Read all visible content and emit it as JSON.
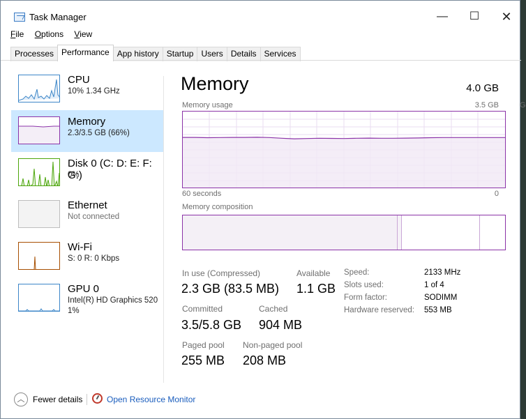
{
  "window": {
    "title": "Task Manager",
    "controls": {
      "minimize": "—",
      "maximize": "☐",
      "close": "✕"
    }
  },
  "menu": [
    "File",
    "Options",
    "View"
  ],
  "tabs": [
    {
      "label": "Processes",
      "active": false
    },
    {
      "label": "Performance",
      "active": true
    },
    {
      "label": "App history",
      "active": false
    },
    {
      "label": "Startup",
      "active": false
    },
    {
      "label": "Users",
      "active": false
    },
    {
      "label": "Details",
      "active": false
    },
    {
      "label": "Services",
      "active": false
    }
  ],
  "sidebar": {
    "items": [
      {
        "name": "CPU",
        "sub": "10% 1.34 GHz",
        "selected": false,
        "graph_color": "#3c86c8"
      },
      {
        "name": "Memory",
        "sub": "2.3/3.5 GB (66%)",
        "selected": true,
        "graph_color": "#8b33a8"
      },
      {
        "name": "Disk 0 (C: D: E: F: G:)",
        "sub": "0%",
        "selected": false,
        "graph_color": "#4da60c"
      },
      {
        "name": "Ethernet",
        "sub": "Not connected",
        "selected": false,
        "graph_color": "#bdbdbd"
      },
      {
        "name": "Wi-Fi",
        "sub": "S: 0 R: 0 Kbps",
        "selected": false,
        "graph_color": "#a74f01"
      },
      {
        "name": "GPU 0",
        "sub": "Intel(R) HD Graphics 520",
        "sub2": "1%",
        "selected": false,
        "graph_color": "#3c86c8"
      }
    ]
  },
  "main": {
    "title": "Memory",
    "total": "4.0 GB",
    "usage_label": "Memory usage",
    "usage_max": "3.5 GB",
    "usage_max_clipped": "G",
    "axis_left": "60 seconds",
    "axis_right": "0",
    "composition_label": "Memory composition",
    "usage_level": 0.66
  },
  "stats": {
    "in_use_label": "In use (Compressed)",
    "in_use_value": "2.3 GB (83.5 MB)",
    "available_label": "Available",
    "available_value": "1.1 GB",
    "committed_label": "Committed",
    "committed_value": "3.5/5.8 GB",
    "cached_label": "Cached",
    "cached_value": "904 MB",
    "paged_label": "Paged pool",
    "paged_value": "255 MB",
    "nonpaged_label": "Non-paged pool",
    "nonpaged_value": "208 MB"
  },
  "specs": [
    {
      "label": "Speed:",
      "value": "2133 MHz"
    },
    {
      "label": "Slots used:",
      "value": "1 of 4"
    },
    {
      "label": "Form factor:",
      "value": "SODIMM"
    },
    {
      "label": "Hardware reserved:",
      "value": "553 MB"
    }
  ],
  "footer": {
    "fewer_details": "Fewer details",
    "resource_monitor": "Open Resource Monitor"
  },
  "colors": {
    "memory_accent": "#8b33a8",
    "selected_bg": "#cce8ff",
    "link": "#1a5dbd"
  }
}
